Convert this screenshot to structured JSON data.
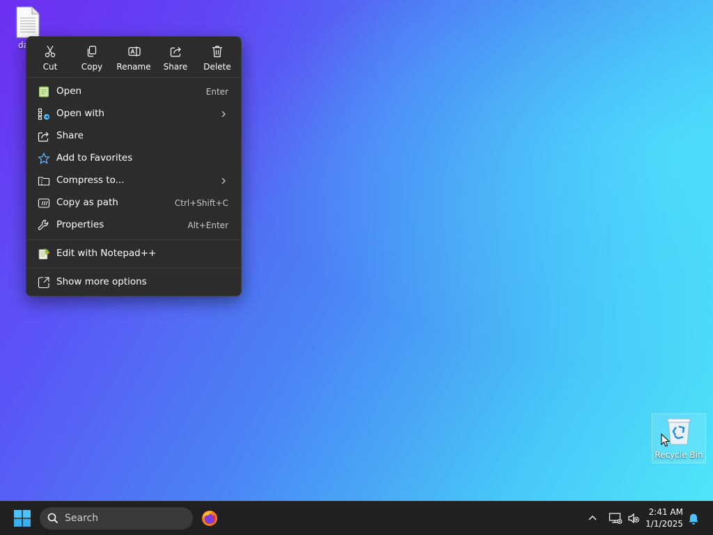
{
  "desktop": {
    "file_label": "da",
    "recycle_bin_label": "Recycle Bin"
  },
  "context_menu": {
    "quick_actions": [
      {
        "label": "Cut",
        "icon": "scissors-icon"
      },
      {
        "label": "Copy",
        "icon": "copy-icon"
      },
      {
        "label": "Rename",
        "icon": "rename-icon"
      },
      {
        "label": "Share",
        "icon": "share-icon"
      },
      {
        "label": "Delete",
        "icon": "trash-icon"
      }
    ],
    "items": [
      {
        "label": "Open",
        "shortcut": "Enter",
        "icon": "notepad-icon"
      },
      {
        "label": "Open with",
        "shortcut": "",
        "icon": "open-with-icon",
        "submenu": true
      },
      {
        "label": "Share",
        "shortcut": "",
        "icon": "share-icon"
      },
      {
        "label": "Add to Favorites",
        "shortcut": "",
        "icon": "star-icon"
      },
      {
        "label": "Compress to...",
        "shortcut": "",
        "icon": "zip-folder-icon",
        "submenu": true
      },
      {
        "label": "Copy as path",
        "shortcut": "Ctrl+Shift+C",
        "icon": "copy-path-icon"
      },
      {
        "label": "Properties",
        "shortcut": "Alt+Enter",
        "icon": "wrench-icon"
      },
      {
        "label": "Edit with Notepad++",
        "shortcut": "",
        "icon": "notepadpp-icon"
      },
      {
        "label": "Show more options",
        "shortcut": "",
        "icon": "more-options-icon"
      }
    ]
  },
  "taskbar": {
    "search_placeholder": "Search",
    "time": "2:41 AM",
    "date": "1/1/2025"
  },
  "colors": {
    "menu_bg": "#2c2c2c",
    "taskbar_bg": "#202020",
    "accent": "#4cc2ff"
  }
}
